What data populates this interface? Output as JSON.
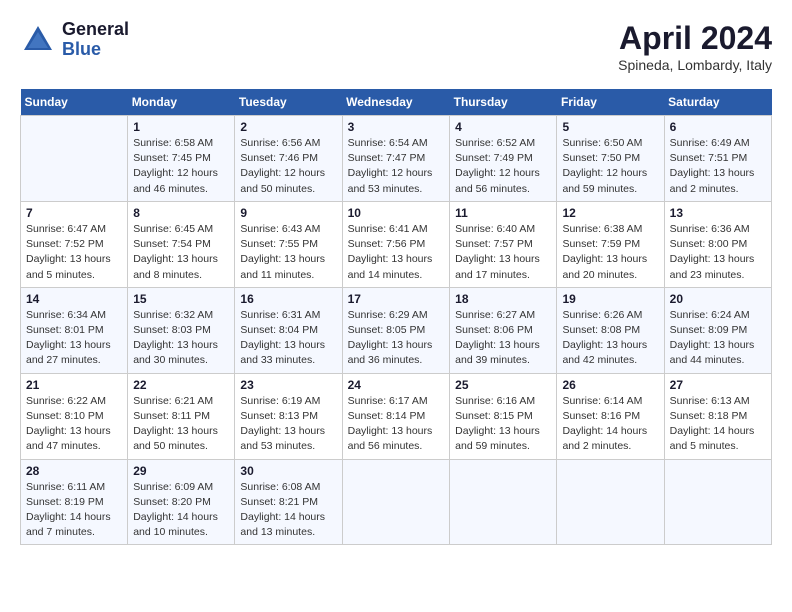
{
  "header": {
    "logo_line1": "General",
    "logo_line2": "Blue",
    "month_title": "April 2024",
    "location": "Spineda, Lombardy, Italy"
  },
  "days_of_week": [
    "Sunday",
    "Monday",
    "Tuesday",
    "Wednesday",
    "Thursday",
    "Friday",
    "Saturday"
  ],
  "weeks": [
    [
      {
        "day": "",
        "info": ""
      },
      {
        "day": "1",
        "info": "Sunrise: 6:58 AM\nSunset: 7:45 PM\nDaylight: 12 hours\nand 46 minutes."
      },
      {
        "day": "2",
        "info": "Sunrise: 6:56 AM\nSunset: 7:46 PM\nDaylight: 12 hours\nand 50 minutes."
      },
      {
        "day": "3",
        "info": "Sunrise: 6:54 AM\nSunset: 7:47 PM\nDaylight: 12 hours\nand 53 minutes."
      },
      {
        "day": "4",
        "info": "Sunrise: 6:52 AM\nSunset: 7:49 PM\nDaylight: 12 hours\nand 56 minutes."
      },
      {
        "day": "5",
        "info": "Sunrise: 6:50 AM\nSunset: 7:50 PM\nDaylight: 12 hours\nand 59 minutes."
      },
      {
        "day": "6",
        "info": "Sunrise: 6:49 AM\nSunset: 7:51 PM\nDaylight: 13 hours\nand 2 minutes."
      }
    ],
    [
      {
        "day": "7",
        "info": "Sunrise: 6:47 AM\nSunset: 7:52 PM\nDaylight: 13 hours\nand 5 minutes."
      },
      {
        "day": "8",
        "info": "Sunrise: 6:45 AM\nSunset: 7:54 PM\nDaylight: 13 hours\nand 8 minutes."
      },
      {
        "day": "9",
        "info": "Sunrise: 6:43 AM\nSunset: 7:55 PM\nDaylight: 13 hours\nand 11 minutes."
      },
      {
        "day": "10",
        "info": "Sunrise: 6:41 AM\nSunset: 7:56 PM\nDaylight: 13 hours\nand 14 minutes."
      },
      {
        "day": "11",
        "info": "Sunrise: 6:40 AM\nSunset: 7:57 PM\nDaylight: 13 hours\nand 17 minutes."
      },
      {
        "day": "12",
        "info": "Sunrise: 6:38 AM\nSunset: 7:59 PM\nDaylight: 13 hours\nand 20 minutes."
      },
      {
        "day": "13",
        "info": "Sunrise: 6:36 AM\nSunset: 8:00 PM\nDaylight: 13 hours\nand 23 minutes."
      }
    ],
    [
      {
        "day": "14",
        "info": "Sunrise: 6:34 AM\nSunset: 8:01 PM\nDaylight: 13 hours\nand 27 minutes."
      },
      {
        "day": "15",
        "info": "Sunrise: 6:32 AM\nSunset: 8:03 PM\nDaylight: 13 hours\nand 30 minutes."
      },
      {
        "day": "16",
        "info": "Sunrise: 6:31 AM\nSunset: 8:04 PM\nDaylight: 13 hours\nand 33 minutes."
      },
      {
        "day": "17",
        "info": "Sunrise: 6:29 AM\nSunset: 8:05 PM\nDaylight: 13 hours\nand 36 minutes."
      },
      {
        "day": "18",
        "info": "Sunrise: 6:27 AM\nSunset: 8:06 PM\nDaylight: 13 hours\nand 39 minutes."
      },
      {
        "day": "19",
        "info": "Sunrise: 6:26 AM\nSunset: 8:08 PM\nDaylight: 13 hours\nand 42 minutes."
      },
      {
        "day": "20",
        "info": "Sunrise: 6:24 AM\nSunset: 8:09 PM\nDaylight: 13 hours\nand 44 minutes."
      }
    ],
    [
      {
        "day": "21",
        "info": "Sunrise: 6:22 AM\nSunset: 8:10 PM\nDaylight: 13 hours\nand 47 minutes."
      },
      {
        "day": "22",
        "info": "Sunrise: 6:21 AM\nSunset: 8:11 PM\nDaylight: 13 hours\nand 50 minutes."
      },
      {
        "day": "23",
        "info": "Sunrise: 6:19 AM\nSunset: 8:13 PM\nDaylight: 13 hours\nand 53 minutes."
      },
      {
        "day": "24",
        "info": "Sunrise: 6:17 AM\nSunset: 8:14 PM\nDaylight: 13 hours\nand 56 minutes."
      },
      {
        "day": "25",
        "info": "Sunrise: 6:16 AM\nSunset: 8:15 PM\nDaylight: 13 hours\nand 59 minutes."
      },
      {
        "day": "26",
        "info": "Sunrise: 6:14 AM\nSunset: 8:16 PM\nDaylight: 14 hours\nand 2 minutes."
      },
      {
        "day": "27",
        "info": "Sunrise: 6:13 AM\nSunset: 8:18 PM\nDaylight: 14 hours\nand 5 minutes."
      }
    ],
    [
      {
        "day": "28",
        "info": "Sunrise: 6:11 AM\nSunset: 8:19 PM\nDaylight: 14 hours\nand 7 minutes."
      },
      {
        "day": "29",
        "info": "Sunrise: 6:09 AM\nSunset: 8:20 PM\nDaylight: 14 hours\nand 10 minutes."
      },
      {
        "day": "30",
        "info": "Sunrise: 6:08 AM\nSunset: 8:21 PM\nDaylight: 14 hours\nand 13 minutes."
      },
      {
        "day": "",
        "info": ""
      },
      {
        "day": "",
        "info": ""
      },
      {
        "day": "",
        "info": ""
      },
      {
        "day": "",
        "info": ""
      }
    ]
  ]
}
